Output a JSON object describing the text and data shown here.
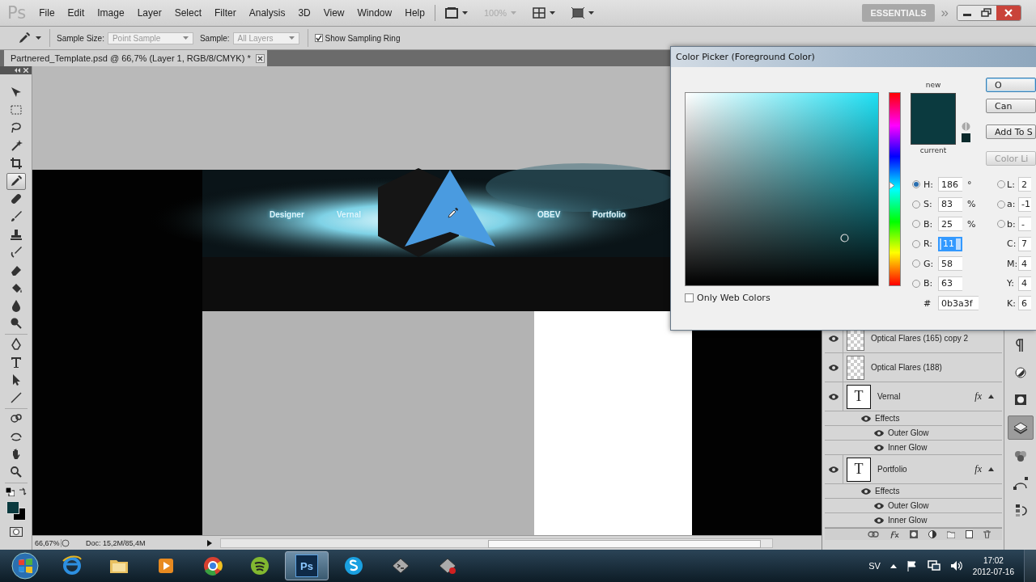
{
  "menubar": {
    "logo": "Ps",
    "menus": [
      "File",
      "Edit",
      "Image",
      "Layer",
      "Select",
      "Filter",
      "Analysis",
      "3D",
      "View",
      "Window",
      "Help"
    ],
    "zoom": "100%",
    "workspace": "ESSENTIALS",
    "more": "»"
  },
  "options": {
    "sample_size_label": "Sample Size:",
    "sample_size": "Point Sample",
    "sample_label": "Sample:",
    "sample": "All Layers",
    "sampling_ring": {
      "label": "Show Sampling Ring",
      "checked": true
    }
  },
  "document_tab": {
    "title": "Partnered_Template.psd @ 66,7% (Layer 1, RGB/8/CMYK) *"
  },
  "tools": [
    {
      "kind": "move",
      "selected": false
    },
    {
      "kind": "marquee",
      "selected": false
    },
    {
      "kind": "lasso",
      "selected": false
    },
    {
      "kind": "wand",
      "selected": false
    },
    {
      "kind": "crop",
      "selected": false
    },
    {
      "kind": "eyedropper",
      "selected": true
    },
    {
      "kind": "healing",
      "selected": false
    },
    {
      "kind": "brush",
      "selected": false
    },
    {
      "kind": "stamp",
      "selected": false
    },
    {
      "kind": "history",
      "selected": false
    },
    {
      "kind": "eraser",
      "selected": false
    },
    {
      "kind": "bucket",
      "selected": false
    },
    {
      "kind": "blur",
      "selected": false
    },
    {
      "kind": "dodge",
      "selected": false
    },
    {
      "kind": "pen",
      "selected": false
    },
    {
      "kind": "type",
      "selected": false
    },
    {
      "kind": "path",
      "selected": false
    },
    {
      "kind": "line",
      "selected": false
    },
    {
      "kind": "rotate3d",
      "selected": false
    },
    {
      "kind": "orbit",
      "selected": false
    },
    {
      "kind": "hand",
      "selected": false
    },
    {
      "kind": "zoom",
      "selected": false
    }
  ],
  "canvas": {
    "banner_labels": [
      "Designer",
      "Vernal",
      "OBEV",
      "Portfolio"
    ]
  },
  "status_bar": {
    "zoom": "66,67%",
    "document_size": "Doc: 15,2M/85,4M"
  },
  "layers": [
    {
      "name": "Optical Flares (165) copy 2",
      "visible": true
    },
    {
      "name": "Optical Flares (188)",
      "visible": true
    },
    {
      "name": "Vernal",
      "kind": "text",
      "thumbnail_text": "T",
      "visible": true,
      "badge": "fx",
      "expanded": true,
      "effects": {
        "name": "Effects",
        "visible": true,
        "children": [
          {
            "name": "Outer Glow",
            "visible": true
          },
          {
            "name": "Inner Glow",
            "visible": true
          }
        ]
      }
    },
    {
      "name": "Portfolio",
      "kind": "text",
      "thumbnail_text": "T",
      "visible": true,
      "badge": "fx",
      "expanded": true,
      "effects": {
        "name": "Effects",
        "visible": true,
        "children": [
          {
            "name": "Outer Glow",
            "visible": true
          },
          {
            "name": "Inner Glow",
            "visible": true
          }
        ]
      }
    }
  ],
  "panel_strip": [
    {
      "kind": "paragraph",
      "selected": false
    },
    {
      "kind": "adjust",
      "selected": false
    },
    {
      "kind": "mask",
      "selected": false
    },
    {
      "kind": "layers",
      "selected": true
    },
    {
      "kind": "channels",
      "selected": false
    },
    {
      "kind": "paths",
      "selected": false
    },
    {
      "kind": "history",
      "selected": false
    }
  ],
  "color_picker": {
    "title": "Color Picker (Foreground Color)",
    "new_label": "new",
    "current_label": "current",
    "buttons": [
      {
        "label": "O",
        "default": true,
        "disabled": false
      },
      {
        "label": "Can",
        "default": false,
        "disabled": false
      },
      {
        "label": "Add To S",
        "default": false,
        "disabled": false
      },
      {
        "label": "Color Li",
        "default": false,
        "disabled": true
      }
    ],
    "fields": [
      {
        "label": "H:",
        "value": "186",
        "unit": "°",
        "selected": true,
        "focused": false
      },
      {
        "label": "S:",
        "value": "83",
        "unit": "%",
        "selected": false,
        "focused": false
      },
      {
        "label": "B:",
        "value": "25",
        "unit": "%",
        "selected": false,
        "focused": false
      },
      {
        "label": "R:",
        "value": "11",
        "selected": false,
        "focused": true
      },
      {
        "label": "G:",
        "value": "58",
        "selected": false,
        "focused": false
      },
      {
        "label": "B:",
        "value": "63",
        "selected": false,
        "focused": false
      }
    ],
    "hue_slider": {
      "level": 0.52
    },
    "hex": {
      "label": "#",
      "value": "0b3a3f"
    },
    "lab_fields": [
      {
        "label": "L:",
        "value": "2",
        "selected": false
      },
      {
        "label": "a:",
        "value": "-1",
        "selected": false
      },
      {
        "label": "b:",
        "value": "-",
        "selected": false
      }
    ],
    "cmyk_fields": [
      {
        "label": "C:",
        "value": "7"
      },
      {
        "label": "M:",
        "value": "4"
      },
      {
        "label": "Y:",
        "value": "4"
      },
      {
        "label": "K:",
        "value": "6"
      }
    ],
    "web_colors": {
      "label": "Only Web Colors",
      "checked": false
    }
  },
  "taskbar": {
    "apps": [
      {
        "kind": "browser",
        "active": false
      },
      {
        "kind": "folder",
        "active": false
      },
      {
        "kind": "media",
        "active": false
      },
      {
        "kind": "chrome",
        "active": false
      },
      {
        "kind": "music",
        "active": false
      },
      {
        "kind": "photoshop",
        "label": "Ps",
        "active": true
      },
      {
        "kind": "chat",
        "active": false
      },
      {
        "kind": "shell",
        "active": false
      },
      {
        "kind": "recorder",
        "active": false
      }
    ],
    "language": "SV",
    "time": "17:02",
    "date": "2012-07-16"
  }
}
